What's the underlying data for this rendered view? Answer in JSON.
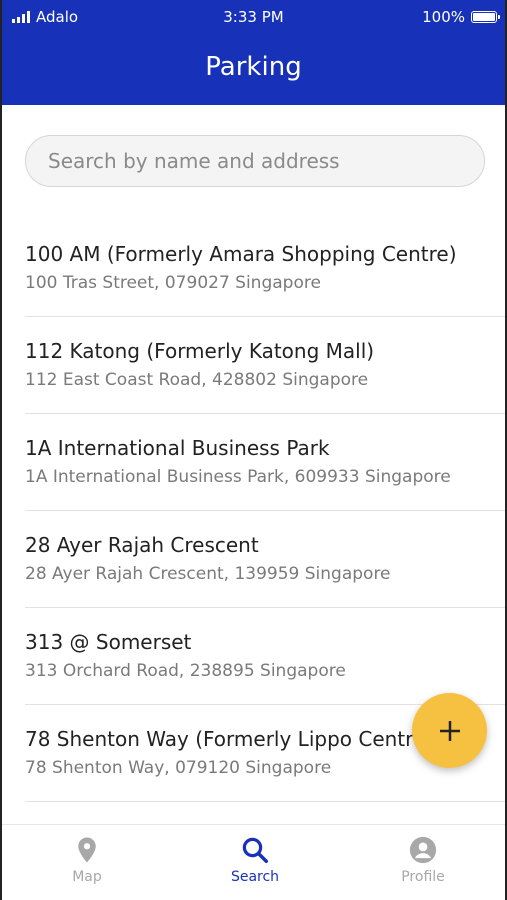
{
  "status_bar": {
    "carrier": "Adalo",
    "time": "3:33 PM",
    "battery": "100%"
  },
  "header": {
    "title": "Parking"
  },
  "search": {
    "placeholder": "Search by name and address",
    "value": ""
  },
  "parking_list": [
    {
      "name": "100 AM (Formerly Amara Shopping Centre)",
      "address": "100 Tras Street, 079027 Singapore"
    },
    {
      "name": "112 Katong (Formerly Katong Mall)",
      "address": "112 East Coast Road, 428802 Singapore"
    },
    {
      "name": "1A International Business Park",
      "address": "1A International Business Park, 609933 Singapore"
    },
    {
      "name": "28 Ayer Rajah Crescent",
      "address": "28 Ayer Rajah Crescent, 139959 Singapore"
    },
    {
      "name": "313 @ Somerset",
      "address": "313 Orchard Road, 238895 Singapore"
    },
    {
      "name": "78 Shenton Way (Formerly Lippo Centre)",
      "address": "78 Shenton Way, 079120 Singapore"
    }
  ],
  "fab": {
    "icon": "plus-icon"
  },
  "tab_bar": {
    "tabs": [
      {
        "label": "Map",
        "icon": "map-pin-icon",
        "active": false
      },
      {
        "label": "Search",
        "icon": "search-icon",
        "active": true
      },
      {
        "label": "Profile",
        "icon": "profile-icon",
        "active": false
      }
    ]
  },
  "colors": {
    "primary": "#1732b8",
    "fab": "#f6c141",
    "tab_inactive": "#a8a8a8"
  }
}
